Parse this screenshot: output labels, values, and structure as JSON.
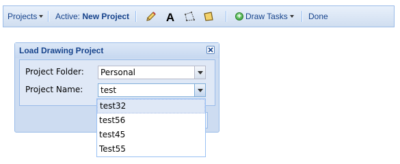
{
  "toolbar": {
    "projects_label": "Projects",
    "active_label": "Active:",
    "active_value": "New Project",
    "tools": [
      "pencil-icon",
      "text-icon",
      "polygon-icon",
      "polygon-fill-icon"
    ],
    "draw_tasks_label": "Draw Tasks",
    "done_label": "Done"
  },
  "dialog": {
    "title": "Load Drawing Project",
    "folder_label": "Project Folder:",
    "folder_value": "Personal",
    "name_label": "Project Name:",
    "name_value": "test"
  },
  "dropdown": {
    "items": [
      "test32",
      "test56",
      "test45",
      "Test55"
    ],
    "highlighted": "test32"
  },
  "colors": {
    "header_text": "#15428b",
    "panel_bg": "#dfe8f6",
    "border": "#99bbe8",
    "add_icon": "#2e9a2e"
  }
}
